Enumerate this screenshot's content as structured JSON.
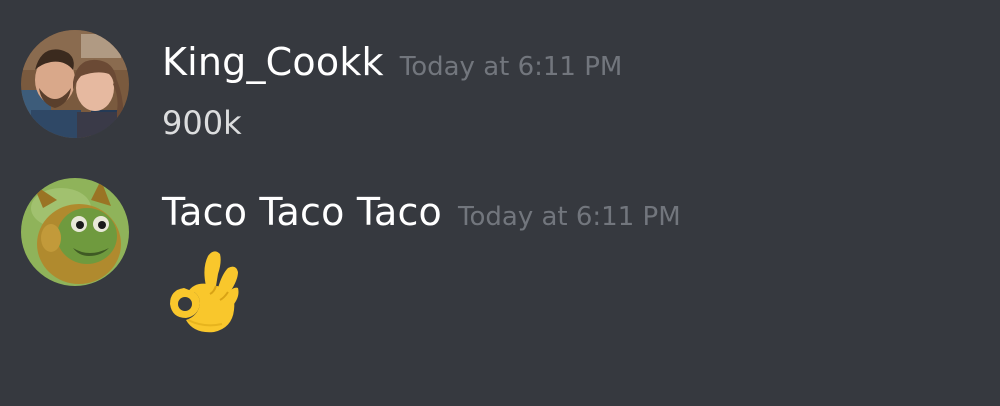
{
  "messages": [
    {
      "username": "King_Cookk",
      "timestamp": "Today at 6:11 PM",
      "content": "900k",
      "avatar_icon": "user-avatar-couple-photo"
    },
    {
      "username": "Taco Taco Taco",
      "timestamp": "Today at 6:11 PM",
      "content_emoji": "ok-hand-emoji",
      "avatar_icon": "user-avatar-cartoon-dog"
    }
  ],
  "colors": {
    "background": "#36393f",
    "username": "#ffffff",
    "timestamp": "#72767d",
    "text": "#dcddde",
    "emoji_yellow": "#f9c72c"
  }
}
